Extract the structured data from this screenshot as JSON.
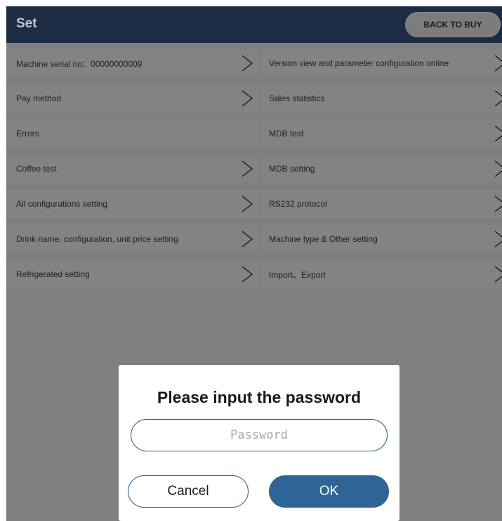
{
  "header": {
    "title": "Set",
    "back_label": "BACK TO BUY"
  },
  "menu": [
    {
      "left": {
        "label": "Machine serial no：00000000009",
        "chevron": true
      },
      "right": {
        "label": "Version view and parameter configuration online",
        "chevron": true
      }
    },
    {
      "left": {
        "label": "Pay method",
        "chevron": true
      },
      "right": {
        "label": "Sales statistics",
        "chevron": true
      }
    },
    {
      "left": {
        "label": "Errors",
        "chevron": false
      },
      "right": {
        "label": "MDB test",
        "chevron": true
      }
    },
    {
      "left": {
        "label": "Coffee test",
        "chevron": true
      },
      "right": {
        "label": "MDB setting",
        "chevron": true
      }
    },
    {
      "left": {
        "label": "All configurations setting",
        "chevron": true
      },
      "right": {
        "label": "RS232 protocol",
        "chevron": true
      }
    },
    {
      "left": {
        "label": "Drink name, configuration, unit price setting",
        "chevron": true
      },
      "right": {
        "label": "Machine type & Other setting",
        "chevron": true
      }
    },
    {
      "left": {
        "label": "Refrigerated setting",
        "chevron": true
      },
      "right": {
        "label": "Import、Export",
        "chevron": true
      }
    }
  ],
  "dialog": {
    "title": "Please input the password",
    "password_placeholder": "Password",
    "password_value": "",
    "cancel_label": "Cancel",
    "ok_label": "OK"
  },
  "colors": {
    "header_bg": "#1c2c44",
    "overlay": "#7f7f7f",
    "accent": "#2f6497"
  }
}
